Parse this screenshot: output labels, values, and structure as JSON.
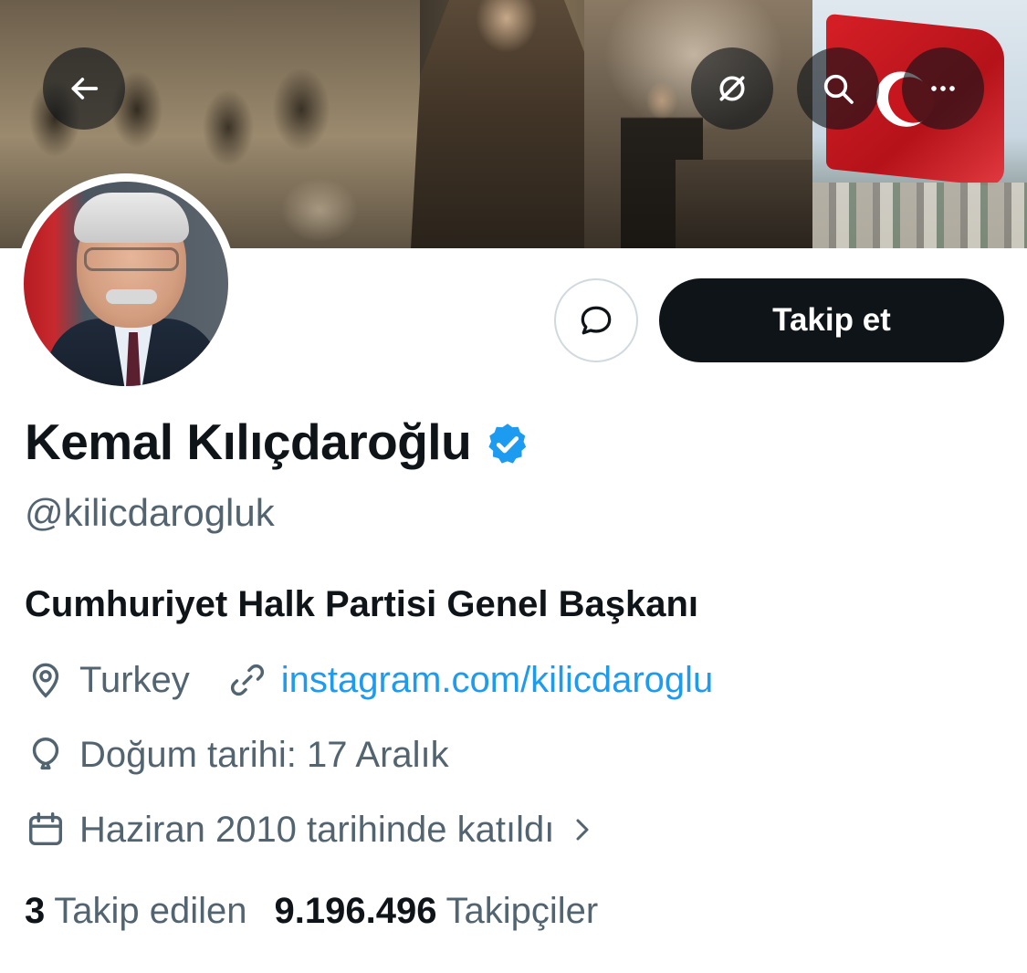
{
  "profile": {
    "display_name": "Kemal Kılıçdaroğlu",
    "handle": "@kilicdarogluk",
    "bio": "Cumhuriyet Halk Partisi Genel Başkanı",
    "location": "Turkey",
    "website": "instagram.com/kilicdaroglu",
    "birth": "Doğum tarihi: 17 Aralık",
    "joined": "Haziran 2010 tarihinde katıldı",
    "verified": true
  },
  "stats": {
    "following_count": "3",
    "following_label": "Takip edilen",
    "followers_count": "9.196.496",
    "followers_label": "Takipçiler"
  },
  "actions": {
    "follow_label": "Takip et"
  },
  "icons": {
    "back": "arrow-left-icon",
    "grok": "grok-icon",
    "search": "search-icon",
    "more": "more-icon",
    "message": "message-icon",
    "verified": "verified-badge-icon",
    "location": "location-pin-icon",
    "link": "link-icon",
    "birth": "balloon-icon",
    "joined": "calendar-icon",
    "chevron": "chevron-right-icon"
  },
  "colors": {
    "accent": "#1d9bf0",
    "text_primary": "#0f1419",
    "text_secondary": "#536471",
    "follow_button": "#0f1419"
  }
}
